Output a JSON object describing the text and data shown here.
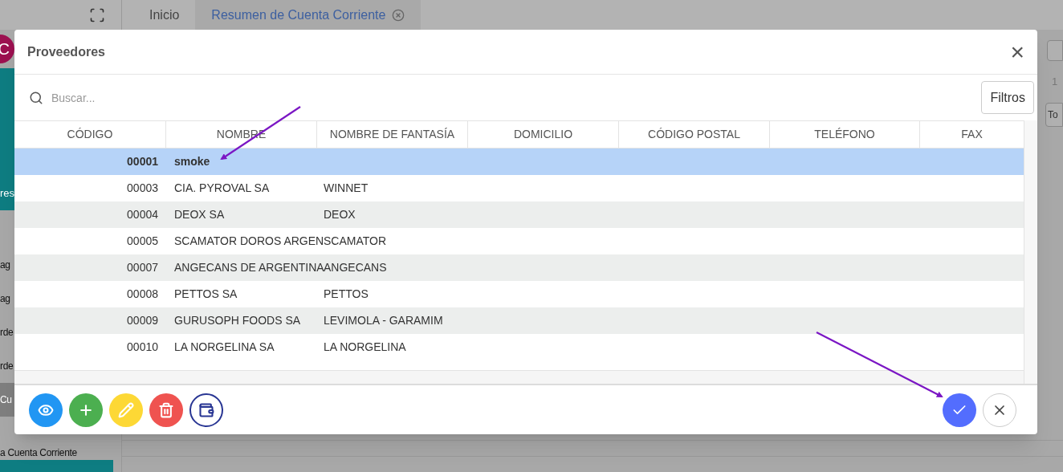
{
  "app": {
    "tabs": [
      {
        "label": "Inicio",
        "selected": false,
        "closable": false
      },
      {
        "label": "Resumen de Cuenta Corriente",
        "selected": true,
        "closable": true
      }
    ],
    "avatar": {
      "initial": "C"
    },
    "sidebar": {
      "banner": {
        "label": "res"
      },
      "items": [
        {
          "label": "ag",
          "kind": "item",
          "selected": false
        },
        {
          "label": "ag",
          "kind": "item",
          "selected": false
        },
        {
          "label": "rde",
          "kind": "item",
          "selected": false
        },
        {
          "label": "rde",
          "kind": "item",
          "selected": false
        },
        {
          "label": "Cu",
          "kind": "item",
          "selected": true
        },
        {
          "label": "a Cuenta Corriente",
          "kind": "item",
          "selected": false
        }
      ]
    },
    "right_edge": {
      "page_number": "1",
      "button_label": "To"
    }
  },
  "modal": {
    "title": "Proveedores",
    "close": "×",
    "search": {
      "placeholder": "Buscar..."
    },
    "filters_button": "Filtros",
    "table": {
      "columns": [
        "CÓDIGO",
        "NOMBRE",
        "NOMBRE DE FANTASÍA",
        "DOMICILIO",
        "CÓDIGO POSTAL",
        "TELÉFONO",
        "FAX"
      ],
      "rows": [
        {
          "code": "00001",
          "name": "smoke",
          "fantasy": "",
          "selected": true
        },
        {
          "code": "00003",
          "name": "CIA. PYROVAL SA",
          "fantasy": "WINNET",
          "selected": false
        },
        {
          "code": "00004",
          "name": "DEOX SA",
          "fantasy": "DEOX",
          "selected": false
        },
        {
          "code": "00005",
          "name": "SCAMATOR DOROS ARGEN",
          "fantasy": "SCAMATOR",
          "selected": false
        },
        {
          "code": "00007",
          "name": "ANGECANS DE ARGENTINA",
          "fantasy": "ANGECANS",
          "selected": false
        },
        {
          "code": "00008",
          "name": "PETTOS SA",
          "fantasy": "PETTOS",
          "selected": false
        },
        {
          "code": "00009",
          "name": "GURUSOPH FOODS SA",
          "fantasy": "LEVIMOLA - GARAMIM",
          "selected": false
        },
        {
          "code": "00010",
          "name": "LA NORGELINA SA",
          "fantasy": "LA NORGELINA",
          "selected": false
        }
      ]
    },
    "actions": [
      {
        "kind": "view"
      },
      {
        "kind": "add"
      },
      {
        "kind": "edit"
      },
      {
        "kind": "delete"
      },
      {
        "kind": "account"
      }
    ],
    "dialog_buttons": [
      {
        "kind": "confirm"
      },
      {
        "kind": "cancel"
      }
    ]
  }
}
